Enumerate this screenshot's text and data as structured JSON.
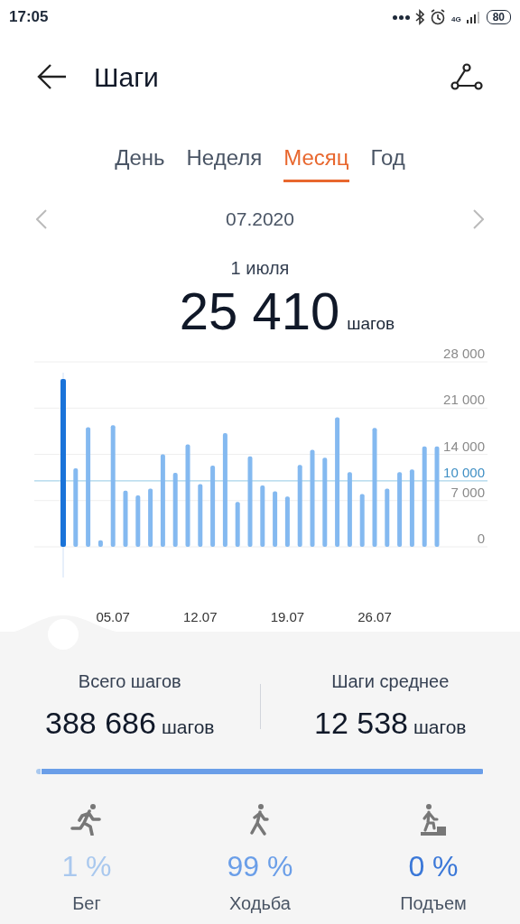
{
  "status_bar": {
    "time": "17:05",
    "network": "4G",
    "battery": "80"
  },
  "header": {
    "title": "Шаги"
  },
  "tabs": [
    {
      "label": "День",
      "selected": false
    },
    {
      "label": "Неделя",
      "selected": false
    },
    {
      "label": "Месяц",
      "selected": true
    },
    {
      "label": "Год",
      "selected": false
    }
  ],
  "period": {
    "label": "07.2020"
  },
  "selected_day": {
    "date": "1 июля",
    "value": "25 410",
    "unit": "шагов"
  },
  "chart": {
    "chart_data": {
      "type": "bar",
      "categories": [
        null,
        null,
        null,
        null,
        "05.07",
        null,
        null,
        null,
        null,
        null,
        null,
        "12.07",
        null,
        null,
        null,
        null,
        null,
        null,
        "19.07",
        null,
        null,
        null,
        null,
        null,
        null,
        "26.07",
        null,
        null,
        null,
        null,
        null
      ],
      "values": [
        25400,
        11900,
        18100,
        1000,
        18400,
        8500,
        7800,
        8800,
        14000,
        11200,
        15500,
        9500,
        12300,
        17200,
        6800,
        13700,
        9300,
        8400,
        7600,
        12400,
        14700,
        13500,
        19600,
        11300,
        8000,
        18000,
        8800,
        11300,
        11700,
        15200,
        15200
      ],
      "grid": true,
      "ylim": [
        0,
        28000
      ],
      "yticks": [
        {
          "value": 0,
          "label": "0"
        },
        {
          "value": 7000,
          "label": "7 000"
        },
        {
          "value": 14000,
          "label": "14 000"
        },
        {
          "value": 21000,
          "label": "21 000"
        },
        {
          "value": 28000,
          "label": "28 000"
        }
      ],
      "ref_lines": [
        {
          "axis": "y",
          "value": 10000,
          "label": "10 000"
        }
      ]
    },
    "bars": [
      {
        "selected": true
      },
      {
        "selected": false
      },
      {
        "selected": false
      },
      {
        "selected": false
      },
      {
        "selected": false
      },
      {
        "selected": false
      },
      {
        "selected": false
      },
      {
        "selected": false
      },
      {
        "selected": false
      },
      {
        "selected": false
      },
      {
        "selected": false
      },
      {
        "selected": false
      },
      {
        "selected": false
      },
      {
        "selected": false
      },
      {
        "selected": false
      },
      {
        "selected": false
      },
      {
        "selected": false
      },
      {
        "selected": false
      },
      {
        "selected": false
      },
      {
        "selected": false
      },
      {
        "selected": false
      },
      {
        "selected": false
      },
      {
        "selected": false
      },
      {
        "selected": false
      },
      {
        "selected": false
      },
      {
        "selected": false
      },
      {
        "selected": false
      },
      {
        "selected": false
      },
      {
        "selected": false
      },
      {
        "selected": false
      },
      {
        "selected": false
      }
    ]
  },
  "totals": [
    {
      "label": "Всего шагов",
      "value": "388 686",
      "unit": "шагов"
    },
    {
      "label": "Шаги среднее",
      "value": "12 538",
      "unit": "шагов"
    }
  ],
  "activities": [
    {
      "kind": "run",
      "label": "Бег",
      "percent": "1 %",
      "color": "#a9c8ee",
      "level": 0.01
    },
    {
      "kind": "walk",
      "label": "Ходьба",
      "percent": "99 %",
      "color": "#6a9ee8",
      "level": 0.99
    },
    {
      "kind": "climb",
      "label": "Подъем",
      "percent": "0 %",
      "color": "#3b78d8"
    }
  ]
}
